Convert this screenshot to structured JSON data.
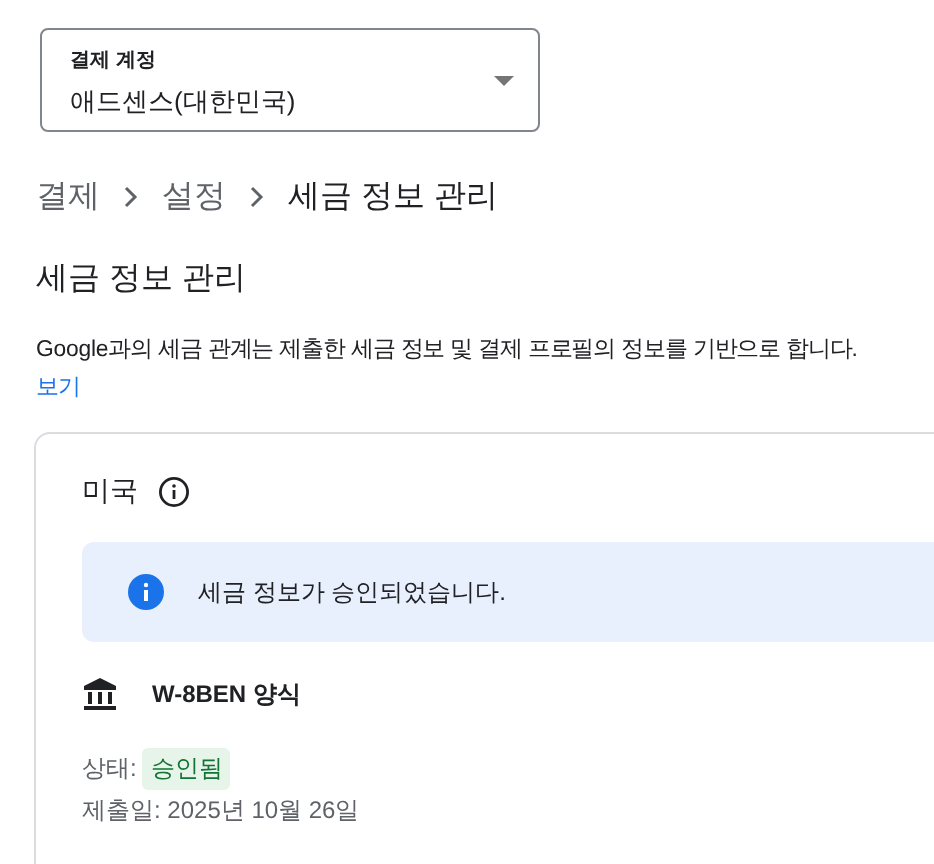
{
  "account_select": {
    "label": "결제 계정",
    "value": "애드센스(대한민국)"
  },
  "breadcrumbs": [
    {
      "label": "결제",
      "current": false
    },
    {
      "label": "설정",
      "current": false
    },
    {
      "label": "세금 정보 관리",
      "current": true
    }
  ],
  "page_title": "세금 정보 관리",
  "description": {
    "text": "Google과의 세금 관계는 제출한 세금 정보 및 결제 프로필의 정보를 기반으로 합니다.",
    "link": "보기"
  },
  "tax_card": {
    "country": "미국",
    "notice": "세금 정보가 승인되었습니다.",
    "form_name": "W-8BEN 양식",
    "status_label": "상태:",
    "status": {
      "text": "승인됨",
      "kind": "approved"
    },
    "submitted": "제출일: 2025년 10월 26일"
  }
}
